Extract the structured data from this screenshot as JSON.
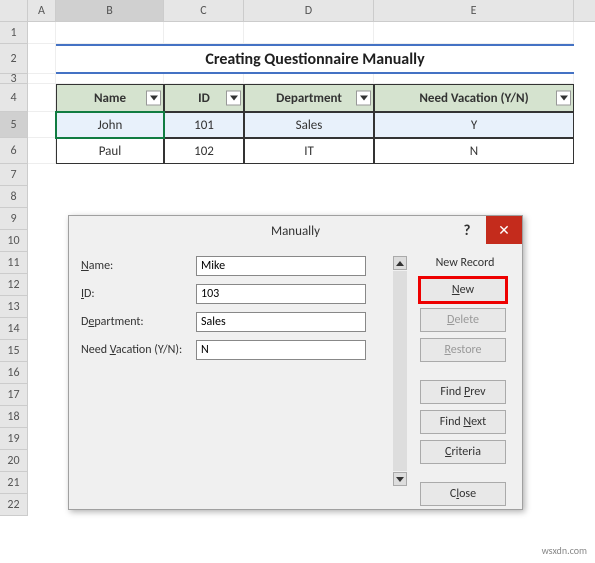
{
  "columns": {
    "A": "A",
    "B": "B",
    "C": "C",
    "D": "D",
    "E": "E"
  },
  "rows": [
    "1",
    "2",
    "3",
    "4",
    "5",
    "6",
    "7",
    "8",
    "9",
    "10",
    "11",
    "12",
    "13",
    "14",
    "15",
    "16",
    "17",
    "18",
    "19",
    "20",
    "21",
    "22"
  ],
  "title": "Creating Questionnaire Manually",
  "table": {
    "headers": {
      "name": "Name",
      "id": "ID",
      "department": "Department",
      "vacation": "Need Vacation (Y/N)"
    },
    "rows": [
      {
        "name": "John",
        "id": "101",
        "department": "Sales",
        "vacation": "Y"
      },
      {
        "name": "Paul",
        "id": "102",
        "department": "IT",
        "vacation": "N"
      }
    ]
  },
  "dialog": {
    "title": "Manually",
    "help": "?",
    "close": "✕",
    "record_status": "New Record",
    "fields": {
      "name_label": "Name:",
      "name_value": "Mike",
      "id_label": "ID:",
      "id_value": "103",
      "dept_label": "Department:",
      "dept_value": "Sales",
      "vac_label_pre": "Need ",
      "vac_label_u": "V",
      "vac_label_post": "acation (Y/N):",
      "vac_value": "N"
    },
    "buttons": {
      "new_pre": "",
      "new_u": "N",
      "new_post": "ew",
      "delete_pre": "",
      "delete_u": "D",
      "delete_post": "elete",
      "restore_pre": "",
      "restore_u": "R",
      "restore_post": "estore",
      "findprev_pre": "Find ",
      "findprev_u": "P",
      "findprev_post": "rev",
      "findnext_pre": "Find ",
      "findnext_u": "N",
      "findnext_post": "ext",
      "criteria_pre": "",
      "criteria_u": "C",
      "criteria_post": "riteria",
      "close_pre": "C",
      "close_u": "l",
      "close_post": "ose"
    }
  },
  "watermark": "wsxdn.com"
}
